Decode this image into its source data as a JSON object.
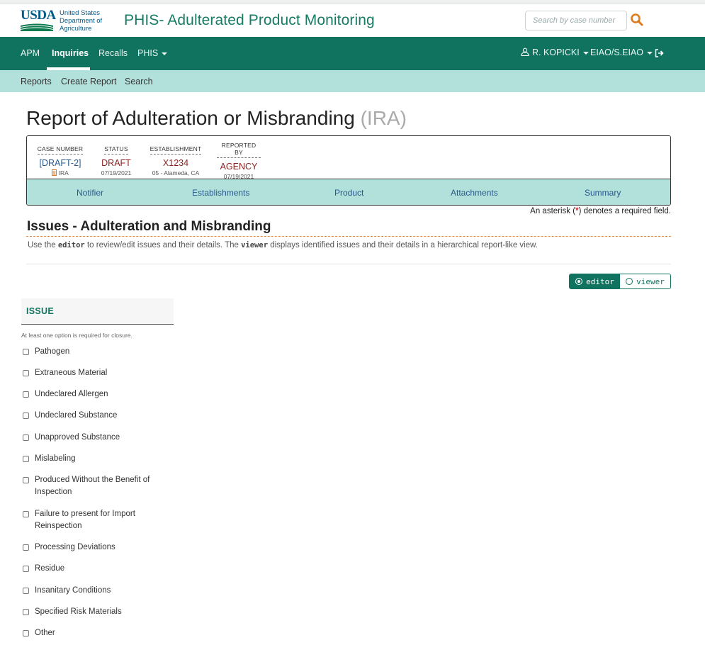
{
  "header": {
    "logo_text": "USDA",
    "department": [
      "United States",
      "Department of",
      "Agriculture"
    ],
    "app_title": "PHIS- Adulterated Product Monitoring",
    "search_placeholder": "Search by case number"
  },
  "main_nav": {
    "items": [
      "APM",
      "Inquiries",
      "Recalls",
      "PHIS"
    ],
    "active": "Inquiries",
    "user": "R. KOPICKI",
    "org": "EIAO/S.EIAO"
  },
  "sub_nav": {
    "items": [
      "Reports",
      "Create Report",
      "Search"
    ]
  },
  "page": {
    "title": "Report of Adulteration or Misbranding",
    "title_suffix": "(IRA)"
  },
  "case": {
    "case_number_label": "CASE NUMBER",
    "case_number": "[DRAFT-2]",
    "case_type": "IRA",
    "status_label": "STATUS",
    "status": "DRAFT",
    "status_date": "07/19/2021",
    "establishment_label": "ESTABLISHMENT",
    "establishment": "X1234",
    "establishment_location": "05 - Alameda, CA",
    "reported_by_label": "REPORTED BY",
    "reported_by": "AGENCY",
    "reported_date": "07/19/2021"
  },
  "tabs": [
    "Notifier",
    "Establishments",
    "Product",
    "Attachments",
    "Summary"
  ],
  "required_note": {
    "prefix": "An asterisk (",
    "symbol": "*",
    "suffix": ") denotes a required field."
  },
  "section": {
    "title": "Issues - Adulteration and Misbranding",
    "desc_1": "Use the ",
    "desc_code_1": "editor",
    "desc_2": " to review/edit issues and their details. The ",
    "desc_code_2": "viewer",
    "desc_3": " displays identified issues and their details in a hierarchical report-like view."
  },
  "view_toggle": {
    "editor": "editor",
    "viewer": "viewer",
    "selected": "editor"
  },
  "issues": {
    "heading": "ISSUE",
    "note": "At least one option is required for closure.",
    "options": [
      "Pathogen",
      "Extraneous Material",
      "Undeclared Allergen",
      "Undeclared Substance",
      "Unapproved Substance",
      "Mislabeling",
      "Produced Without the Benefit of Inspection",
      "Failure to present for Import Reinspection",
      "Processing Deviations",
      "Residue",
      "Insanitary Conditions",
      "Specified Risk Materials",
      "Other"
    ]
  },
  "colors": {
    "primary": "#10735f",
    "secondary": "#b2e0db",
    "accent_orange": "#e07a1f",
    "required_red": "#d9262c",
    "usda_blue": "#005a8a"
  }
}
